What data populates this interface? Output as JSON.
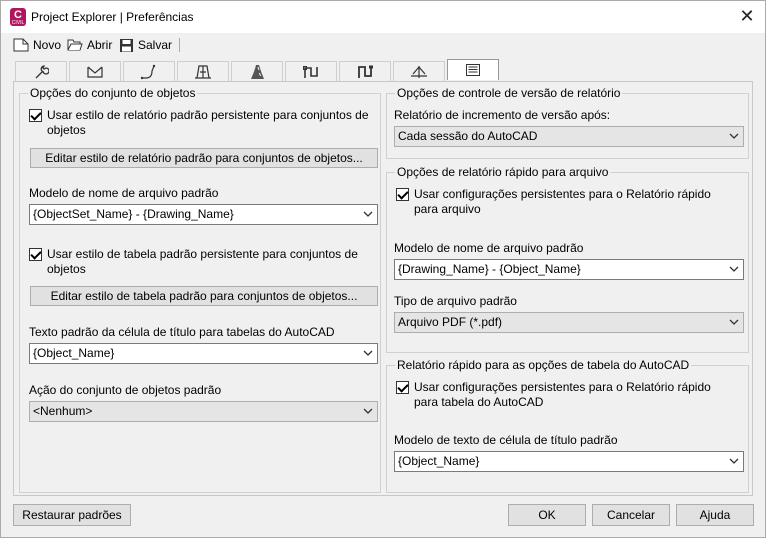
{
  "window": {
    "title": "Project Explorer | Preferências",
    "app_icon_letter": "C",
    "app_icon_sub": "CIVIL"
  },
  "toolbar": {
    "new_label": "Novo",
    "open_label": "Abrir",
    "save_label": "Salvar"
  },
  "tabs": [
    {
      "icon": "wrench-icon"
    },
    {
      "icon": "envelope-icon"
    },
    {
      "icon": "alignment-curve-icon"
    },
    {
      "icon": "parcel-icon"
    },
    {
      "icon": "road-icon"
    },
    {
      "icon": "pipe-network-icon"
    },
    {
      "icon": "pressure-network-icon"
    },
    {
      "icon": "profile-icon"
    },
    {
      "icon": "report-icon",
      "active": true
    }
  ],
  "left": {
    "group_title": "Opções do conjunto de objetos",
    "report_style_check": "Usar estilo de relatório padrão persistente para conjuntos de objetos",
    "edit_report_button": "Editar estilo de relatório padrão para conjuntos de objetos...",
    "filename_label": "Modelo de nome de arquivo padrão",
    "filename_value": "{ObjectSet_Name} - {Drawing_Name}",
    "table_style_check": "Usar estilo de tabela padrão persistente para conjuntos de objetos",
    "edit_table_button": "Editar estilo de tabela padrão para conjuntos de objetos...",
    "title_cell_label": "Texto padrão da célula de título para tabelas do AutoCAD",
    "title_cell_value": "{Object_Name}",
    "action_label": "Ação do conjunto de objetos padrão",
    "action_value": "<Nenhum>"
  },
  "version": {
    "group_title": "Opções de controle de versão de relatório",
    "increment_label": "Relatório de incremento de versão após:",
    "increment_value": "Cada sessão do AutoCAD"
  },
  "quick_file": {
    "group_title": "Opções de relatório rápido para arquivo",
    "persist_check": "Usar configurações persistentes para o Relatório rápido para arquivo",
    "filename_label": "Modelo de nome de arquivo padrão",
    "filename_value": "{Drawing_Name} - {Object_Name}",
    "filetype_label": "Tipo de arquivo padrão",
    "filetype_value": "Arquivo PDF (*.pdf)"
  },
  "quick_table": {
    "group_title": "Relatório rápido para as opções de tabela do AutoCAD",
    "persist_check": "Usar configurações persistentes para o Relatório rápido para tabela do AutoCAD",
    "title_cell_label": "Modelo de texto de célula de título padrão",
    "title_cell_value": "{Object_Name}"
  },
  "footer": {
    "restore_label": "Restaurar padrões",
    "ok_label": "OK",
    "cancel_label": "Cancelar",
    "help_label": "Ajuda"
  }
}
